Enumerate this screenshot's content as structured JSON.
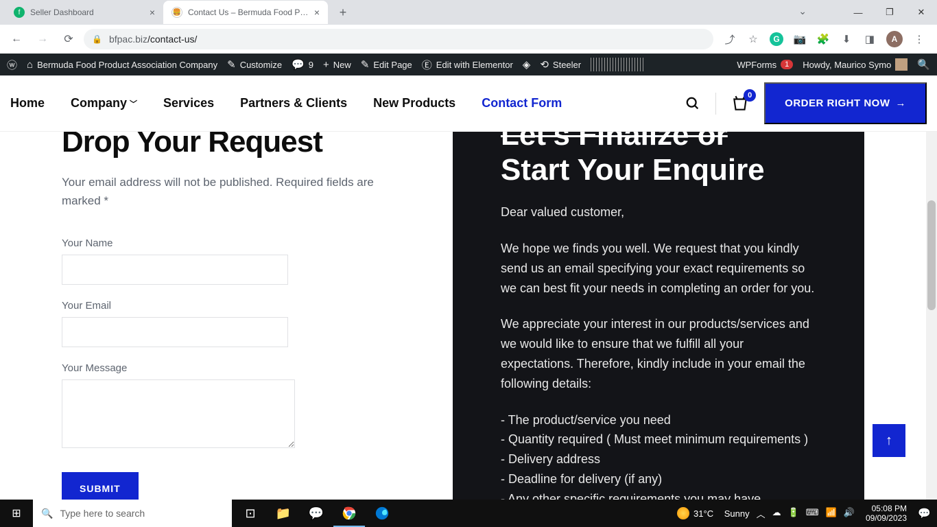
{
  "browser": {
    "tabs": [
      {
        "title": "Seller Dashboard"
      },
      {
        "title": "Contact Us – Bermuda Food Proc"
      }
    ],
    "url_domain": "bfpac.biz",
    "url_path": "/contact-us/",
    "avatar_letter": "A"
  },
  "wpbar": {
    "site": "Bermuda Food Product Association Company",
    "customize": "Customize",
    "comments": "9",
    "new": "New",
    "edit_page": "Edit Page",
    "edit_elementor": "Edit with Elementor",
    "steeler": "Steeler",
    "wpforms": "WPForms",
    "wpforms_badge": "1",
    "howdy": "Howdy, Maurico Symo"
  },
  "nav": {
    "home": "Home",
    "company": "Company",
    "services": "Services",
    "partners": "Partners & Clients",
    "new_products": "New Products",
    "contact": "Contact Form",
    "cart_count": "0",
    "order_btn": "ORDER RIGHT NOW"
  },
  "form": {
    "heading": "Drop Your Request",
    "subtext": "Your email address will not be published. Required fields are marked *",
    "name_label": "Your Name",
    "email_label": "Your Email",
    "message_label": "Your Message",
    "submit": "SUBMIT"
  },
  "enquire": {
    "heading_line1": "Let's Finalize or",
    "heading_line2": "Start Your Enquire",
    "p1": "Dear valued customer,",
    "p2": "We hope we finds you well. We request that you kindly send us an email specifying your exact requirements so we can best fit your needs in completing an order for you.",
    "p3": "We appreciate your interest in our products/services and we would like to ensure that we fulfill all your expectations. Therefore, kindly include in your email the following details:",
    "b1": "- The product/service you need",
    "b2": "- Quantity required ( Must meet minimum requirements )",
    "b3": "- Delivery address",
    "b4": "- Deadline for delivery (if any)",
    "b5": "- Any other specific requirements you may have"
  },
  "taskbar": {
    "search_placeholder": "Type here to search",
    "weather_temp": "31°C",
    "weather_cond": "Sunny",
    "time": "05:08 PM",
    "date": "09/09/2023"
  }
}
